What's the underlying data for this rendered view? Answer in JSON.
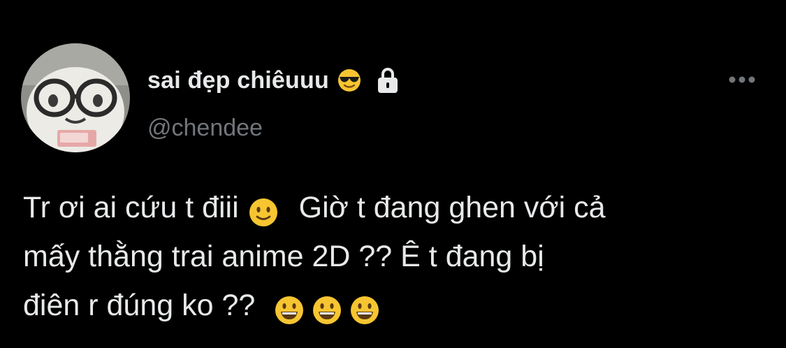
{
  "tweet": {
    "display_name": "sai đẹp chiêuuu",
    "name_emoji": "smiling-face-with-sunglasses-icon",
    "protected_icon": "lock-icon",
    "handle": "@chendee",
    "more_icon": "more-horizontal-icon",
    "body": {
      "line1_part1": "Tr ơi ai cứu t điii",
      "line1_emoji": "slightly-smiling-face-icon",
      "line1_part2": "Giờ t đang ghen với cả",
      "line2": "mấy thằng trai anime 2D ?? Ê t đang bị",
      "line3_text": "điên r đúng ko ??",
      "line3_emojis": [
        "grinning-face-icon",
        "grinning-face-icon",
        "grinning-face-icon"
      ]
    }
  },
  "colors": {
    "background": "#000000",
    "primary_text": "#e7e9ea",
    "secondary_text": "#71767b",
    "emoji_yellow": "#f7c531"
  }
}
